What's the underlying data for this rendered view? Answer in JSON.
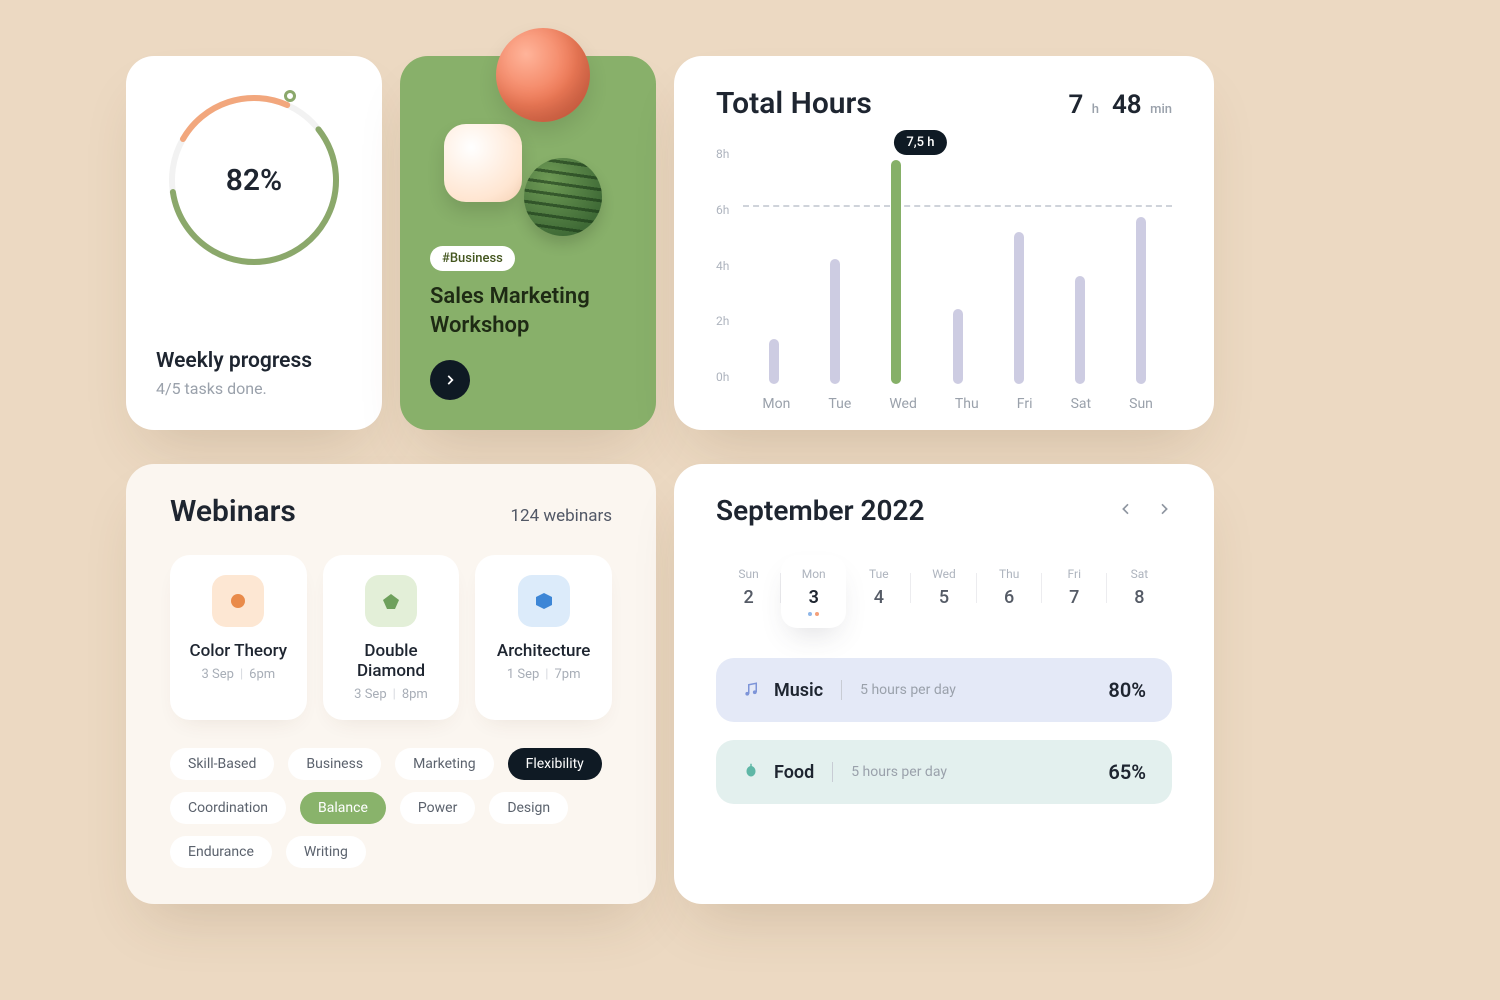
{
  "progress": {
    "percent": "82%",
    "title": "Weekly progress",
    "subtitle": "4/5 tasks done."
  },
  "workshop": {
    "tag": "#Business",
    "title": "Sales Marketing Workshop"
  },
  "hours": {
    "title": "Total Hours",
    "h": "7",
    "h_unit": "h",
    "m": "48",
    "m_unit": "min",
    "tooltip": "7,5 h"
  },
  "chart_data": {
    "type": "bar",
    "categories": [
      "Mon",
      "Tue",
      "Wed",
      "Thu",
      "Fri",
      "Sat",
      "Sun"
    ],
    "values": [
      1.5,
      4.2,
      7.5,
      2.5,
      5.1,
      3.6,
      5.6
    ],
    "title": "Total Hours",
    "ylabel": "hours",
    "ylim": [
      0,
      8
    ],
    "yticks": [
      "8h",
      "6h",
      "4h",
      "2h",
      "0h"
    ],
    "highlight_index": 2,
    "highlight_label": "7,5 h",
    "reference_line": 6
  },
  "webinars": {
    "title": "Webinars",
    "count": "124 webinars",
    "items": [
      {
        "name": "Color Theory",
        "date": "3 Sep",
        "time": "6pm"
      },
      {
        "name": "Double Diamond",
        "date": "3 Sep",
        "time": "8pm"
      },
      {
        "name": "Architecture",
        "date": "1 Sep",
        "time": "7pm"
      }
    ],
    "tags": [
      "Skill-Based",
      "Business",
      "Marketing",
      "Flexibility",
      "Coordination",
      "Balance",
      "Power",
      "Design",
      "Endurance",
      "Writing"
    ]
  },
  "calendar": {
    "title": "September 2022",
    "days": [
      {
        "name": "Sun",
        "num": "2"
      },
      {
        "name": "Mon",
        "num": "3",
        "active": true
      },
      {
        "name": "Tue",
        "num": "4"
      },
      {
        "name": "Wed",
        "num": "5"
      },
      {
        "name": "Thu",
        "num": "6"
      },
      {
        "name": "Fri",
        "num": "7"
      },
      {
        "name": "Sat",
        "num": "8"
      }
    ],
    "tracks": [
      {
        "name": "Music",
        "sub": "5 hours per day",
        "value": "80%"
      },
      {
        "name": "Food",
        "sub": "5 hours per day",
        "value": "65%"
      }
    ]
  }
}
